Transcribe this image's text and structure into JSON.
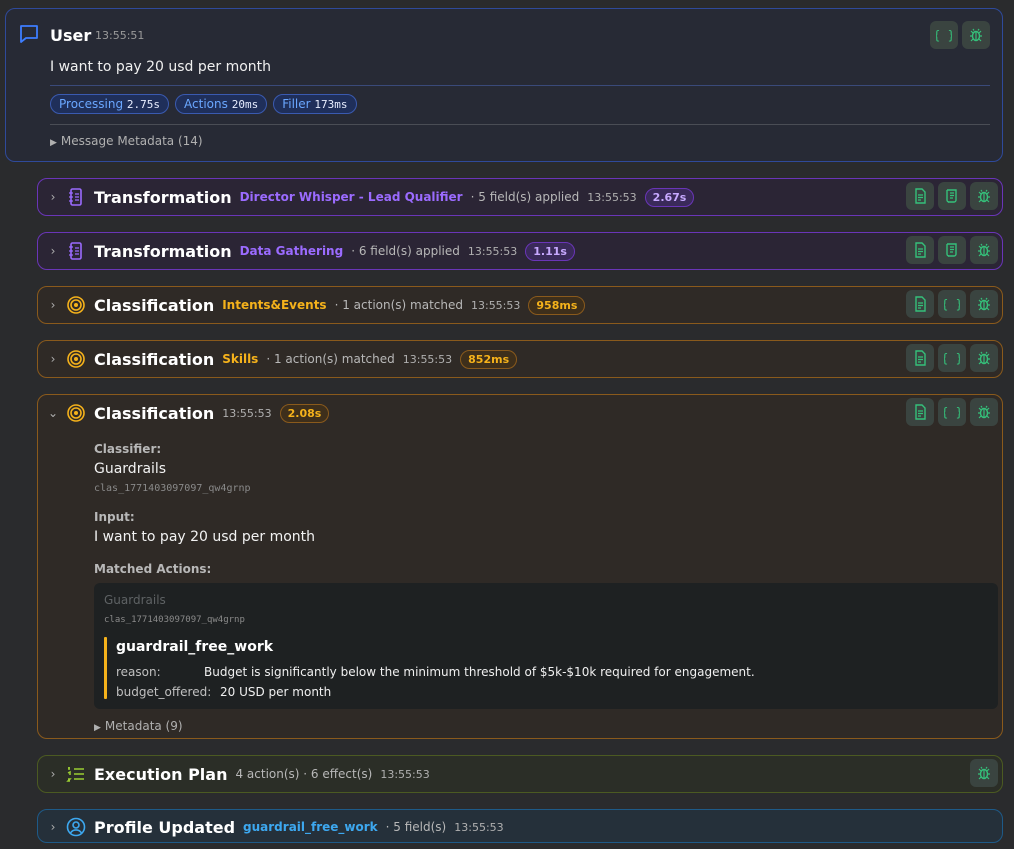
{
  "user": {
    "title": "User",
    "time": "13:55:51",
    "message": "I want to pay 20 usd per month",
    "pills": [
      {
        "label": "Processing",
        "value": "2.75s"
      },
      {
        "label": "Actions",
        "value": "20ms"
      },
      {
        "label": "Filler",
        "value": "173ms"
      }
    ],
    "metadata_toggle": "Message Metadata (14)",
    "actions": [
      "code-braces-icon",
      "bug-icon"
    ]
  },
  "steps": [
    {
      "title": "Transformation",
      "subtitle": "Director Whisper - Lead Qualifier",
      "meta": "· 5 field(s) applied",
      "time": "13:55:53",
      "duration": "2.67s"
    },
    {
      "title": "Transformation",
      "subtitle": "Data Gathering",
      "meta": "· 6 field(s) applied",
      "time": "13:55:53",
      "duration": "1.11s"
    },
    {
      "title": "Classification",
      "subtitle": "Intents&Events",
      "meta": "· 1 action(s) matched",
      "time": "13:55:53",
      "duration": "958ms"
    },
    {
      "title": "Classification",
      "subtitle": "Skills",
      "meta": "· 1 action(s) matched",
      "time": "13:55:53",
      "duration": "852ms"
    },
    {
      "title": "Classification",
      "time": "13:55:53",
      "duration": "2.08s",
      "classifier_label": "Classifier:",
      "classifier_name": "Guardrails",
      "classifier_id": "clas_1771403097097_qw4grnp",
      "input_label": "Input:",
      "input_value": "I want to pay 20 usd per month",
      "matched_label": "Matched Actions:",
      "matched": {
        "name": "Guardrails",
        "id": "clas_1771403097097_qw4grnp",
        "action": "guardrail_free_work",
        "reason_key": "reason:",
        "reason_value": "Budget is significantly below the minimum threshold of $5k-$10k required for engagement.",
        "budget_key": "budget_offered:",
        "budget_value": "20 USD per month"
      },
      "metadata_toggle": "Metadata (9)"
    },
    {
      "title": "Execution Plan",
      "meta": "4 action(s) · 6 effect(s)",
      "time": "13:55:53"
    },
    {
      "title": "Profile Updated",
      "subtitle": "guardrail_free_work",
      "meta": "· 5 field(s)",
      "time": "13:55:53"
    }
  ],
  "colors": {
    "purple": "#9b6bff",
    "orange": "#f5b21b",
    "green_icon": "#35c07a",
    "blue": "#3da8f0"
  }
}
